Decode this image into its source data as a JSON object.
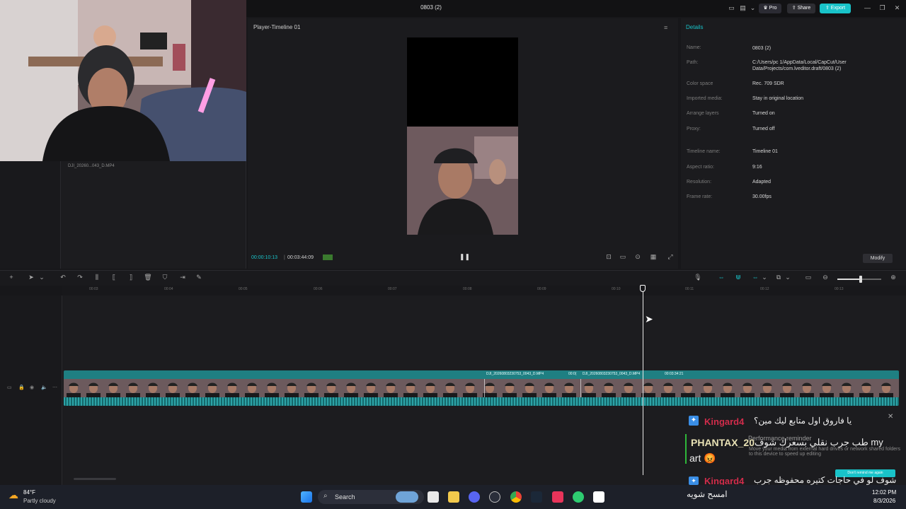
{
  "titlebar": {
    "title": "0803 (2)",
    "pro_label": "Pro",
    "share_label": "Share",
    "export_label": "Export"
  },
  "media": {
    "file_name": "DJI_20260...043_D.MP4"
  },
  "player": {
    "title": "Player-Timeline 01",
    "current_time": "00:00:10:13",
    "separator": "|",
    "duration": "00:03:44:09"
  },
  "details": {
    "title": "Details",
    "rows": [
      {
        "label": "Name:",
        "value": "0803 (2)"
      },
      {
        "label": "Path:",
        "value": "C:/Users/pc 1/AppData/Local/CapCut/User Data/Projects/com.lveditor.draft/0803 (2)"
      },
      {
        "label": "Color space",
        "value": "Rec. 709 SDR"
      },
      {
        "label": "Imported media:",
        "value": "Stay in original location"
      },
      {
        "label": "Arrange layers",
        "value": "Turned on"
      },
      {
        "label": "Proxy:",
        "value": "Turned off"
      },
      {
        "label": "Timeline name:",
        "value": "Timeline 01"
      },
      {
        "label": "Aspect ratio:",
        "value": "9:16"
      },
      {
        "label": "Resolution:",
        "value": "Adapted"
      },
      {
        "label": "Frame rate:",
        "value": "30.00fps"
      }
    ],
    "modify_label": "Modify"
  },
  "ruler": {
    "ticks": [
      "00:03",
      "00:04",
      "00:05",
      "00:06",
      "00:07",
      "00:08",
      "00:09",
      "00:10",
      "00:11",
      "00:12",
      "00:13"
    ]
  },
  "clip": {
    "label_1": "DJI_20260803230753_0043_D.MP4",
    "label_2": "00:0(",
    "label_3": "DJI_20260803230753_0043_D.MP4",
    "label_4": "00:03:34:21"
  },
  "chat": {
    "user1": "Kingard4",
    "msg1": "يا فاروق اول متابع ليك مين؟",
    "user2": "PHANTAX_20",
    "msg2": "طب جرب نقلي بسعرك شوف my",
    "msg2b": "art 😡",
    "user3": "Kingard4",
    "msg3": "شوف لو في حاجات كتيره محفوظه جرب",
    "msg3b": "امسح شويه",
    "popup_title": "Performance reminder",
    "popup_body": "Move your media from external hard drives or network shared folders to this device to speed up editing",
    "popup_btn": "Don't remind me again"
  },
  "taskbar": {
    "temp": "84°F",
    "weather": "Partly cloudy",
    "search": "Search",
    "time": "12:02 PM",
    "date": "8/3/2026"
  },
  "colors": {
    "accent": "#19c3c9",
    "clip": "#1f7f82",
    "bg": "#17171a"
  }
}
